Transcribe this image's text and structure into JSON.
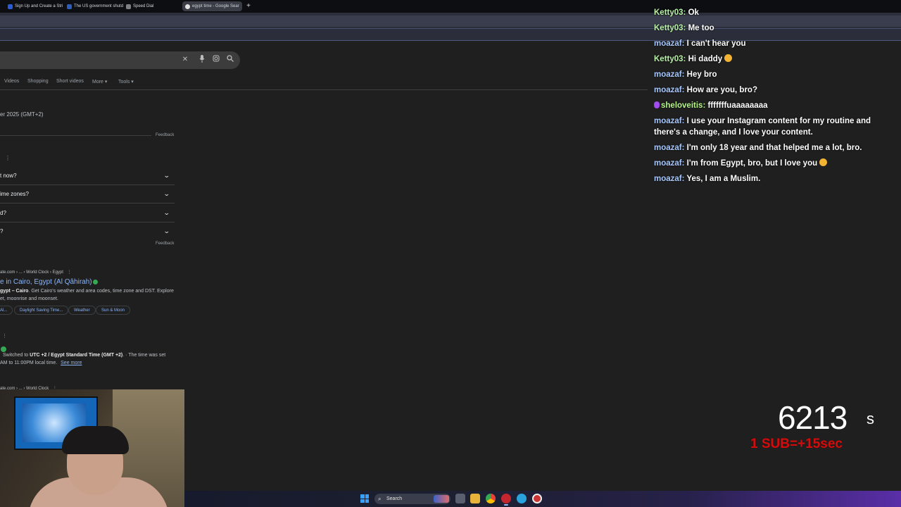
{
  "browser": {
    "tabs": [
      {
        "title": "Sign Up and Create a Stri",
        "favicon_color": "#2a5bd7"
      },
      {
        "title": "The US government shutd",
        "favicon_color": "#2d5db8"
      },
      {
        "title": "Speed Dial",
        "favicon_color": "#808080"
      },
      {
        "title": "egypt time - Google Sear",
        "favicon_color": "#e2e2e2",
        "active": true
      }
    ],
    "new_tab_label": "+"
  },
  "search": {
    "icons": [
      "close-icon",
      "mic-icon",
      "lens-icon",
      "search-icon"
    ],
    "filters": [
      "Videos",
      "Shopping",
      "Short videos",
      "More ▾",
      "Tools ▾"
    ]
  },
  "results": {
    "time_text": "er 2025 (GMT+2)",
    "feedback_label": "Feedback",
    "paa_questions": [
      "t now?",
      "ime zones?",
      "d?",
      "?"
    ],
    "result1": {
      "cite": "ate.com › ... › World Clock › Egypt",
      "title": "e in Cairo, Egypt (Al Qâhirah)",
      "snippet_bold": "gypt – Cairo",
      "snippet_line1": ". Get Cairo's weather and area codes, time zone and DST. Explore",
      "snippet_line2": "et, moonrise and moonset.",
      "chips": [
        "Al...",
        "Daylight Saving Time...",
        "Weather",
        "Sun & Moon"
      ]
    },
    "result2": {
      "snippet_pre": "Switched to ",
      "snippet_bold": "UTC +2 / Egypt Standard Time (GMT +2)",
      "snippet_post": ". · The time was set",
      "snippet_line2": "AM to 11:00PM local time.",
      "see_more": "See more"
    },
    "result3": {
      "cite": "ate.com › ... › World Clock"
    }
  },
  "chat": {
    "messages": [
      {
        "user": "Ketty03:",
        "text": "Ok",
        "color": "green"
      },
      {
        "user": "Ketty03:",
        "text": "Me too",
        "color": "green"
      },
      {
        "user": "moazaf:",
        "text": "I can't hear you",
        "color": "blue"
      },
      {
        "user": "Ketty03:",
        "text": "Hi daddy",
        "color": "green",
        "emoji": true
      },
      {
        "user": "moazaf:",
        "text": "Hey bro",
        "color": "blue"
      },
      {
        "user": "moazaf:",
        "text": "How are you, bro?",
        "color": "blue"
      },
      {
        "user": "sheloveitis:",
        "text": "fffffffuaaaaaaaa",
        "color": "lime",
        "badge": true
      },
      {
        "user": "moazaf:",
        "text": "I use your Instagram content for my routine and",
        "text2": "there's a change, and I love your content.",
        "color": "blue"
      },
      {
        "user": "moazaf:",
        "text": "I'm only 18 year and that helped me a lot, bro.",
        "color": "blue"
      },
      {
        "user": "moazaf:",
        "text": "I'm from Egypt, bro, but I love you",
        "color": "blue",
        "emoji": true
      },
      {
        "user": "moazaf:",
        "text": "Yes, I am a Muslim.",
        "color": "blue"
      }
    ]
  },
  "subathon": {
    "timer": "6213",
    "unit": "s",
    "rule": "1 SUB=+15sec",
    "rule_color": "#d10d0d"
  },
  "taskbar": {
    "search_label": "Search",
    "apps": [
      "start-icon",
      "file-explorer-icon",
      "task-view-icon",
      "folder-icon",
      "chrome-icon",
      "opera-icon",
      "telegram-icon",
      "app-icon"
    ]
  }
}
